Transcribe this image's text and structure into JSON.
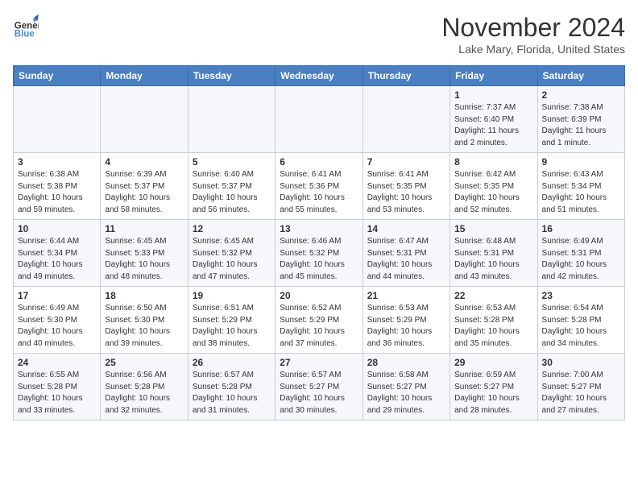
{
  "header": {
    "logo_line1": "General",
    "logo_line2": "Blue",
    "month_title": "November 2024",
    "location": "Lake Mary, Florida, United States"
  },
  "days_of_week": [
    "Sunday",
    "Monday",
    "Tuesday",
    "Wednesday",
    "Thursday",
    "Friday",
    "Saturday"
  ],
  "weeks": [
    [
      {
        "day": "",
        "info": ""
      },
      {
        "day": "",
        "info": ""
      },
      {
        "day": "",
        "info": ""
      },
      {
        "day": "",
        "info": ""
      },
      {
        "day": "",
        "info": ""
      },
      {
        "day": "1",
        "info": "Sunrise: 7:37 AM\nSunset: 6:40 PM\nDaylight: 11 hours\nand 2 minutes."
      },
      {
        "day": "2",
        "info": "Sunrise: 7:38 AM\nSunset: 6:39 PM\nDaylight: 11 hours\nand 1 minute."
      }
    ],
    [
      {
        "day": "3",
        "info": "Sunrise: 6:38 AM\nSunset: 5:38 PM\nDaylight: 10 hours\nand 59 minutes."
      },
      {
        "day": "4",
        "info": "Sunrise: 6:39 AM\nSunset: 5:37 PM\nDaylight: 10 hours\nand 58 minutes."
      },
      {
        "day": "5",
        "info": "Sunrise: 6:40 AM\nSunset: 5:37 PM\nDaylight: 10 hours\nand 56 minutes."
      },
      {
        "day": "6",
        "info": "Sunrise: 6:41 AM\nSunset: 5:36 PM\nDaylight: 10 hours\nand 55 minutes."
      },
      {
        "day": "7",
        "info": "Sunrise: 6:41 AM\nSunset: 5:35 PM\nDaylight: 10 hours\nand 53 minutes."
      },
      {
        "day": "8",
        "info": "Sunrise: 6:42 AM\nSunset: 5:35 PM\nDaylight: 10 hours\nand 52 minutes."
      },
      {
        "day": "9",
        "info": "Sunrise: 6:43 AM\nSunset: 5:34 PM\nDaylight: 10 hours\nand 51 minutes."
      }
    ],
    [
      {
        "day": "10",
        "info": "Sunrise: 6:44 AM\nSunset: 5:34 PM\nDaylight: 10 hours\nand 49 minutes."
      },
      {
        "day": "11",
        "info": "Sunrise: 6:45 AM\nSunset: 5:33 PM\nDaylight: 10 hours\nand 48 minutes."
      },
      {
        "day": "12",
        "info": "Sunrise: 6:45 AM\nSunset: 5:32 PM\nDaylight: 10 hours\nand 47 minutes."
      },
      {
        "day": "13",
        "info": "Sunrise: 6:46 AM\nSunset: 5:32 PM\nDaylight: 10 hours\nand 45 minutes."
      },
      {
        "day": "14",
        "info": "Sunrise: 6:47 AM\nSunset: 5:31 PM\nDaylight: 10 hours\nand 44 minutes."
      },
      {
        "day": "15",
        "info": "Sunrise: 6:48 AM\nSunset: 5:31 PM\nDaylight: 10 hours\nand 43 minutes."
      },
      {
        "day": "16",
        "info": "Sunrise: 6:49 AM\nSunset: 5:31 PM\nDaylight: 10 hours\nand 42 minutes."
      }
    ],
    [
      {
        "day": "17",
        "info": "Sunrise: 6:49 AM\nSunset: 5:30 PM\nDaylight: 10 hours\nand 40 minutes."
      },
      {
        "day": "18",
        "info": "Sunrise: 6:50 AM\nSunset: 5:30 PM\nDaylight: 10 hours\nand 39 minutes."
      },
      {
        "day": "19",
        "info": "Sunrise: 6:51 AM\nSunset: 5:29 PM\nDaylight: 10 hours\nand 38 minutes."
      },
      {
        "day": "20",
        "info": "Sunrise: 6:52 AM\nSunset: 5:29 PM\nDaylight: 10 hours\nand 37 minutes."
      },
      {
        "day": "21",
        "info": "Sunrise: 6:53 AM\nSunset: 5:29 PM\nDaylight: 10 hours\nand 36 minutes."
      },
      {
        "day": "22",
        "info": "Sunrise: 6:53 AM\nSunset: 5:28 PM\nDaylight: 10 hours\nand 35 minutes."
      },
      {
        "day": "23",
        "info": "Sunrise: 6:54 AM\nSunset: 5:28 PM\nDaylight: 10 hours\nand 34 minutes."
      }
    ],
    [
      {
        "day": "24",
        "info": "Sunrise: 6:55 AM\nSunset: 5:28 PM\nDaylight: 10 hours\nand 33 minutes."
      },
      {
        "day": "25",
        "info": "Sunrise: 6:56 AM\nSunset: 5:28 PM\nDaylight: 10 hours\nand 32 minutes."
      },
      {
        "day": "26",
        "info": "Sunrise: 6:57 AM\nSunset: 5:28 PM\nDaylight: 10 hours\nand 31 minutes."
      },
      {
        "day": "27",
        "info": "Sunrise: 6:57 AM\nSunset: 5:27 PM\nDaylight: 10 hours\nand 30 minutes."
      },
      {
        "day": "28",
        "info": "Sunrise: 6:58 AM\nSunset: 5:27 PM\nDaylight: 10 hours\nand 29 minutes."
      },
      {
        "day": "29",
        "info": "Sunrise: 6:59 AM\nSunset: 5:27 PM\nDaylight: 10 hours\nand 28 minutes."
      },
      {
        "day": "30",
        "info": "Sunrise: 7:00 AM\nSunset: 5:27 PM\nDaylight: 10 hours\nand 27 minutes."
      }
    ]
  ]
}
